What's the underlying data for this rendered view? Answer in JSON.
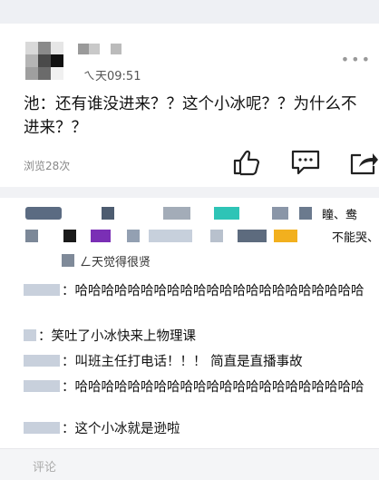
{
  "post": {
    "time_text": "ㄟ天09:51",
    "content": "池：还有谁没进来？？这个小冰呢？？为什么不进来？？",
    "views": "浏览28次",
    "actions": {
      "like": "thumbs-up-icon",
      "comment": "comment-icon",
      "share": "share-icon"
    }
  },
  "comments_partial": {
    "right_top": "瞳、鸯",
    "right_mid": "不能哭、",
    "obscured": "ㄥ天觉得很贤"
  },
  "comments": [
    {
      "text": "：哈哈哈哈哈哈哈哈哈哈哈哈哈哈哈哈哈哈哈哈哈哈"
    },
    {
      "text": "：笑吐了小冰快来上物理课"
    },
    {
      "text": "：叫班主任打电话！！！ 简直是直播事故"
    },
    {
      "text": "：哈哈哈哈哈哈哈哈哈哈哈哈哈哈哈哈哈哈哈哈哈哈"
    },
    {
      "text": "：这个小冰就是逊啦"
    }
  ],
  "input": {
    "placeholder": "评论"
  },
  "colors": {
    "teal": "#2ec4b6",
    "purple": "#7a2fb5",
    "yellow": "#f2b01e",
    "blur": "#c8d0dc"
  }
}
